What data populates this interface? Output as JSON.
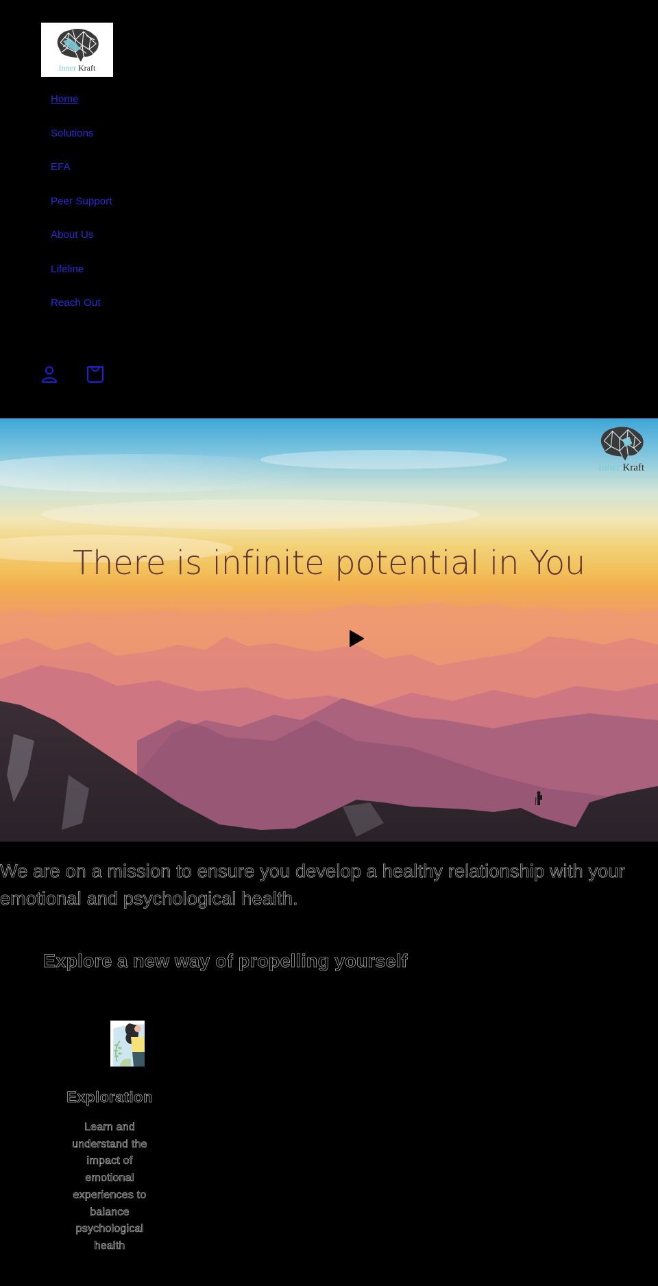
{
  "brand": {
    "name_part1": "Inner",
    "name_part2": "Kraft",
    "colors": {
      "inner": "#7fcbd8",
      "kraft": "#2b2b2b",
      "nav_link": "#2b2bd8",
      "hero_title": "#5e3232"
    }
  },
  "nav": {
    "items": [
      {
        "label": "Home",
        "active": true
      },
      {
        "label": "Solutions"
      },
      {
        "label": "EFA"
      },
      {
        "label": "Peer Support"
      },
      {
        "label": "About Us"
      },
      {
        "label": "Lifeline"
      },
      {
        "label": "Reach Out"
      }
    ]
  },
  "header_icons": {
    "account": "account-icon",
    "cart": "cart-icon"
  },
  "hero": {
    "title": "There is infinite potential in You",
    "play_icon": "play-icon"
  },
  "mission": {
    "text": "We are on a mission to ensure you develop a healthy relationship with your emotional and psychological health."
  },
  "explore": {
    "heading": "Explore a new way of propelling yourself",
    "cards": [
      {
        "title": "Exploration",
        "description": "Learn and understand the impact of emotional experiences to balance psychological health"
      }
    ]
  }
}
